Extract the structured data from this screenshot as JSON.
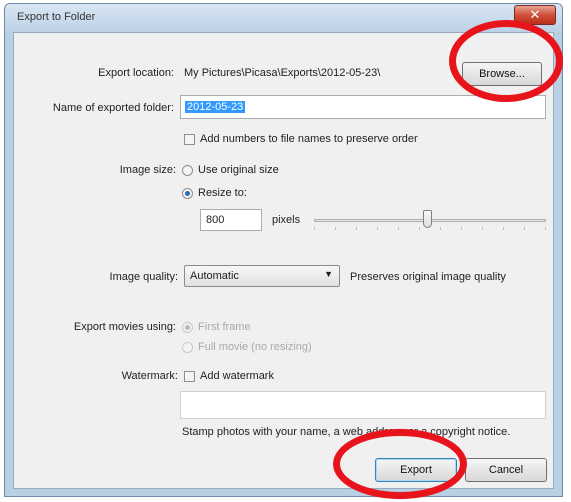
{
  "window": {
    "title": "Export to Folder",
    "close_glyph": "✕"
  },
  "location": {
    "label": "Export location:",
    "path": "My Pictures\\Picasa\\Exports\\2012-05-23\\",
    "browse_label": "Browse..."
  },
  "folder": {
    "label": "Name of exported folder:",
    "value": "2012-05-23"
  },
  "add_numbers": {
    "label": "Add numbers to file names to preserve order",
    "checked": false
  },
  "image_size": {
    "label": "Image size:",
    "options": [
      {
        "label": "Use original size",
        "selected": false
      },
      {
        "label": "Resize to:",
        "selected": true
      }
    ],
    "pixels_value": "800",
    "pixels_unit": "pixels",
    "slider_fraction": 0.49
  },
  "image_quality": {
    "label": "Image quality:",
    "selected": "Automatic",
    "description": "Preserves original image quality"
  },
  "export_movies": {
    "label": "Export movies using:",
    "options": [
      {
        "label": "First frame",
        "selected": true
      },
      {
        "label": "Full movie (no resizing)",
        "selected": false
      }
    ]
  },
  "watermark": {
    "label": "Watermark:",
    "checkbox_label": "Add watermark",
    "text": "",
    "hint": "Stamp photos with your name, a web address or a copyright notice."
  },
  "buttons": {
    "export": "Export",
    "cancel": "Cancel"
  },
  "colors": {
    "highlight_ring": "#e8141b",
    "selection": "#3399ff"
  }
}
